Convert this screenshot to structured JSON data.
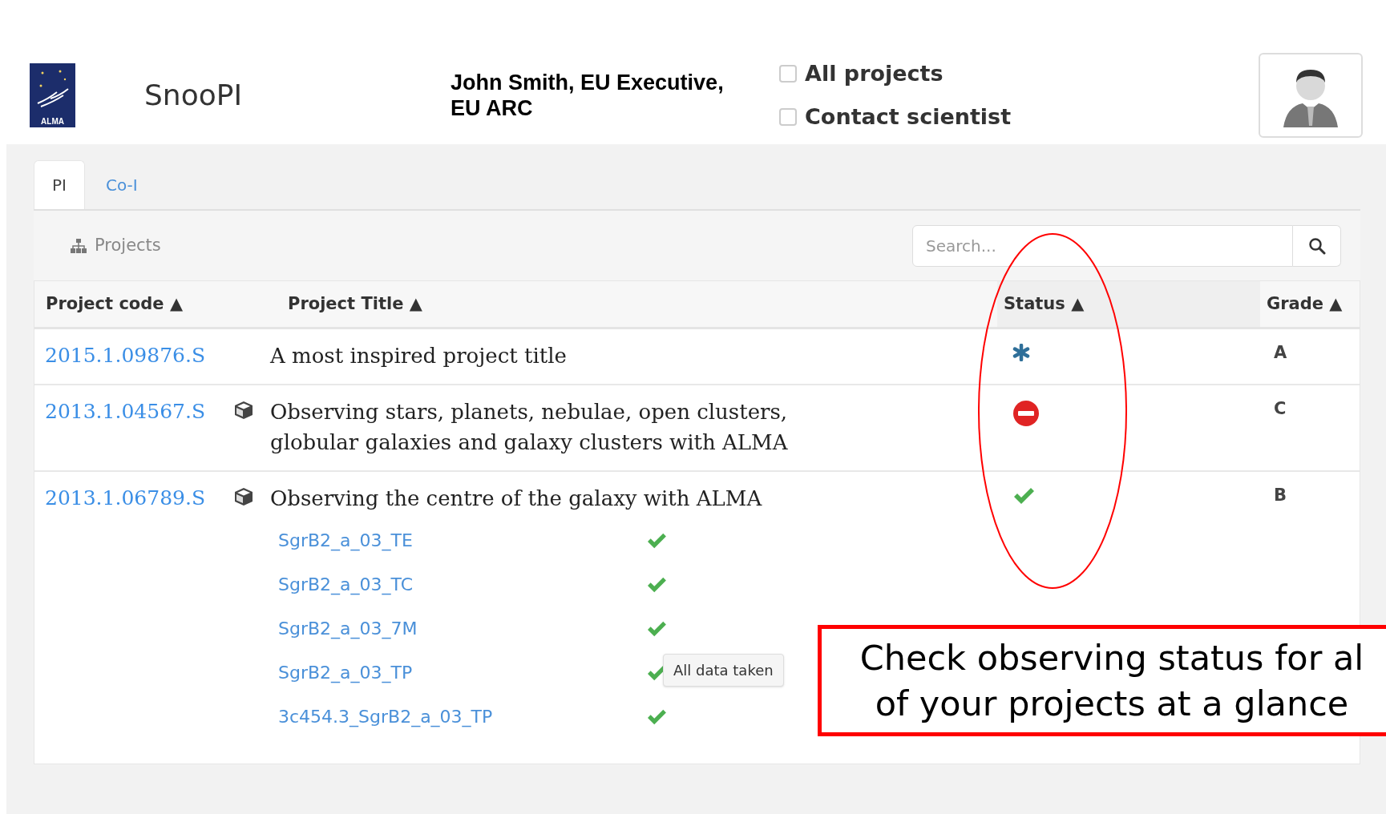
{
  "header": {
    "logo_text": "ALMA",
    "app_name": "SnooPI",
    "user": "John Smith, EU Executive, EU ARC",
    "filters": [
      {
        "label": "All projects",
        "checked": false
      },
      {
        "label": "Contact scientist",
        "checked": false
      }
    ]
  },
  "tabs": [
    {
      "label": "PI",
      "selected": true
    },
    {
      "label": "Co-I",
      "selected": false
    }
  ],
  "toolbar": {
    "title": "Projects",
    "search": {
      "placeholder": "Search..."
    }
  },
  "table": {
    "columns": [
      "Project code ▲",
      "Project Title ▲",
      "Status ▲",
      "Grade ▲"
    ],
    "rows": [
      {
        "code": "2015.1.09876.S",
        "has_package": false,
        "title": "A most inspired project title",
        "kind": "in-progress",
        "grade": "A",
        "children": []
      },
      {
        "code": "2013.1.04567.S",
        "has_package": true,
        "title": "Observing stars, planets, nebulae, open clusters, globular galaxies and galaxy clusters with ALMA",
        "kind": "blocked",
        "grade": "C",
        "children": []
      },
      {
        "code": "2013.1.06789.S",
        "has_package": true,
        "title": "Observing the centre of the galaxy with ALMA",
        "kind": "done",
        "grade": "B",
        "children": [
          {
            "name": "SgrB2_a_03_TE",
            "kind": "done"
          },
          {
            "name": "SgrB2_a_03_TC",
            "kind": "done"
          },
          {
            "name": "SgrB2_a_03_7M",
            "kind": "done"
          },
          {
            "name": "SgrB2_a_03_TP",
            "kind": "done",
            "tooltip": "All data taken"
          },
          {
            "name": "3c454.3_SgrB2_a_03_TP",
            "kind": "done"
          }
        ]
      }
    ]
  },
  "annotation": {
    "lines": [
      "Check observing status for al",
      "of your projects at a glance"
    ]
  }
}
